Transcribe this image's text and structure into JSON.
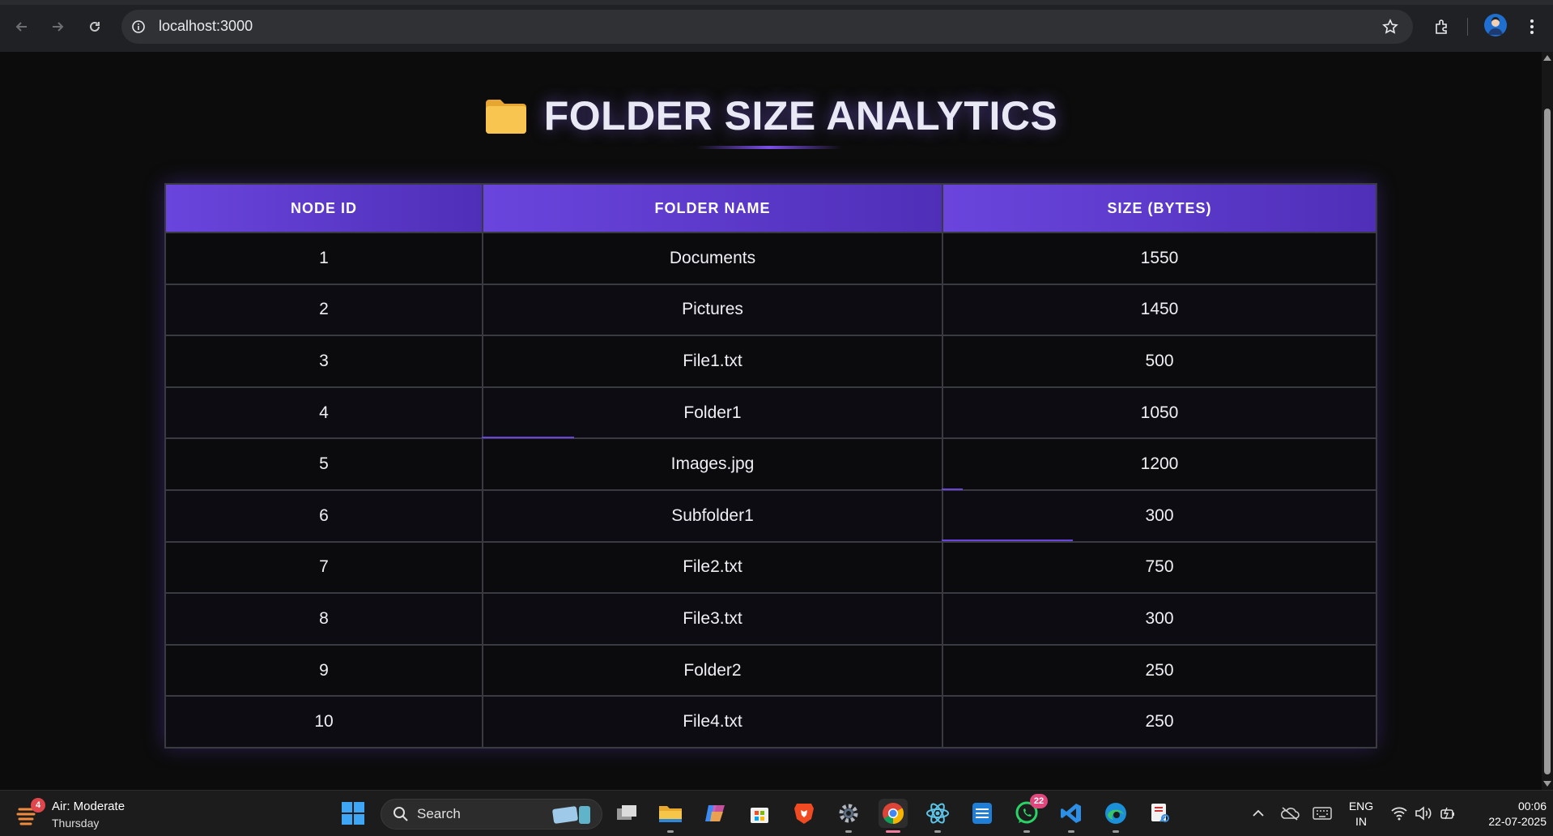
{
  "browser": {
    "url": "localhost:3000"
  },
  "page": {
    "title": "FOLDER SIZE ANALYTICS",
    "title_icon": "folder-icon"
  },
  "table": {
    "headers": [
      "NODE ID",
      "FOLDER NAME",
      "SIZE (BYTES)"
    ],
    "rows": [
      {
        "id": "1",
        "name": "Documents",
        "size": "1550"
      },
      {
        "id": "2",
        "name": "Pictures",
        "size": "1450"
      },
      {
        "id": "3",
        "name": "File1.txt",
        "size": "500"
      },
      {
        "id": "4",
        "name": "Folder1",
        "size": "1050"
      },
      {
        "id": "5",
        "name": "Images.jpg",
        "size": "1200"
      },
      {
        "id": "6",
        "name": "Subfolder1",
        "size": "300"
      },
      {
        "id": "7",
        "name": "File2.txt",
        "size": "750"
      },
      {
        "id": "8",
        "name": "File3.txt",
        "size": "300"
      },
      {
        "id": "9",
        "name": "Folder2",
        "size": "250"
      },
      {
        "id": "10",
        "name": "File4.txt",
        "size": "250"
      }
    ]
  },
  "taskbar": {
    "weather_badge": "4",
    "weather_line1": "Air: Moderate",
    "weather_line2": "Thursday",
    "search_label": "Search",
    "whatsapp_badge": "22",
    "lang_line1": "ENG",
    "lang_line2": "IN",
    "time": "00:06",
    "date": "22-07-2025"
  },
  "colors": {
    "accent": "#6a45dd",
    "background": "#0c0c0c",
    "folder": "#f6c244"
  }
}
